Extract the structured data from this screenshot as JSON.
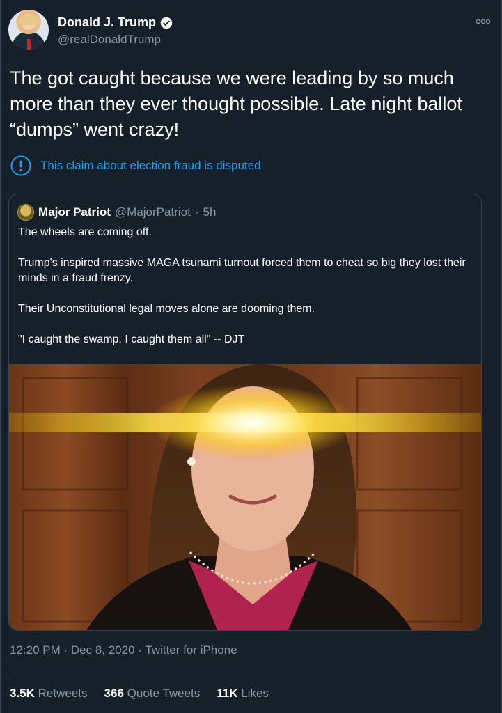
{
  "author": {
    "display_name": "Donald J. Trump",
    "handle": "@realDonaldTrump",
    "verified": true
  },
  "tweet": {
    "text": "The got caught because we were leading by so much more than they ever thought possible. Late night ballot “dumps” went crazy!",
    "notice": "This claim about election fraud is disputed"
  },
  "quoted": {
    "display_name": "Major Patriot",
    "handle": "@MajorPatriot",
    "separator": "·",
    "time": "5h",
    "paragraphs": [
      "The wheels are coming off.",
      "Trump's inspired massive MAGA tsunami turnout forced them to cheat so big they lost their minds in a fraud frenzy.",
      "Their Unconstitutional legal moves alone are dooming them.",
      "\"I caught the swamp. I caught them all\" -- DJT"
    ]
  },
  "meta": {
    "time": "12:20 PM",
    "date": "Dec 8, 2020",
    "source": "Twitter for iPhone",
    "full": "12:20 PM · Dec 8, 2020 · Twitter for iPhone"
  },
  "stats": {
    "retweets_count": "3.5K",
    "retweets_label": "Retweets",
    "quote_count": "366",
    "quote_label": "Quote Tweets",
    "likes_count": "11K",
    "likes_label": "Likes"
  },
  "colors": {
    "background": "#15202b",
    "accent": "#1da1f2",
    "muted": "#8899a6",
    "border": "#38444d"
  }
}
